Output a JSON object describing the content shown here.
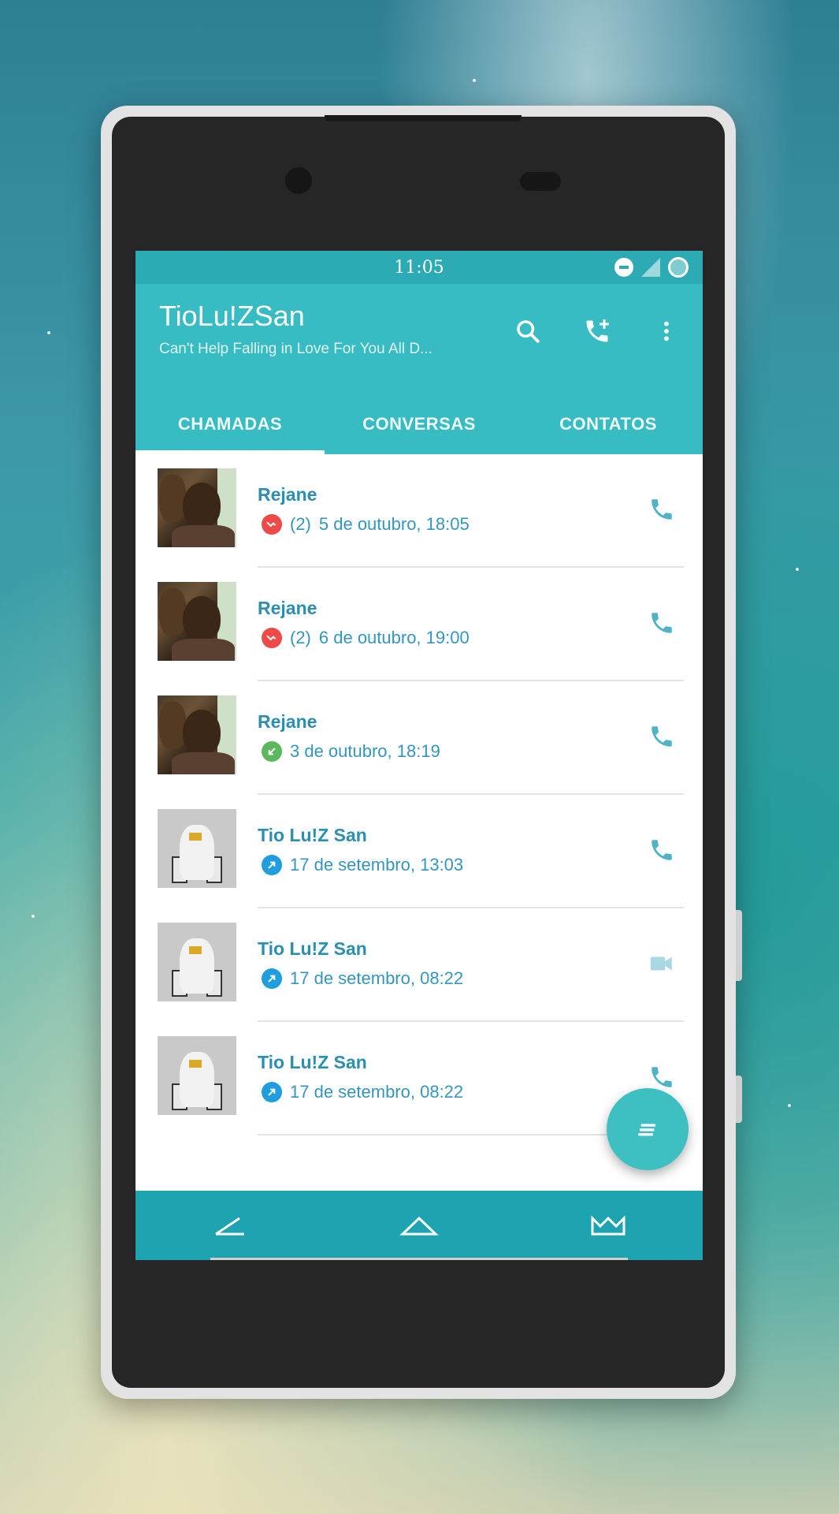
{
  "status_bar": {
    "time": "11:05"
  },
  "app_bar": {
    "title": "TioLu!ZSan",
    "subtitle": "Can't Help Falling in Love For You All D..."
  },
  "tabs": [
    {
      "label": "CHAMADAS",
      "selected": true
    },
    {
      "label": "CONVERSAS",
      "selected": false
    },
    {
      "label": "CONTATOS",
      "selected": false
    }
  ],
  "calls": [
    {
      "name": "Rejane",
      "count": "(2)",
      "date": "5 de outubro, 18:05",
      "status": "missed",
      "action_icon": "phone-icon"
    },
    {
      "name": "Rejane",
      "count": "(2)",
      "date": "6 de outubro, 19:00",
      "status": "missed",
      "action_icon": "phone-icon"
    },
    {
      "name": "Rejane",
      "count": "",
      "date": "3 de outubro, 18:19",
      "status": "received",
      "action_icon": "phone-icon"
    },
    {
      "name": "Tio Lu!Z San",
      "count": "",
      "date": "17 de setembro, 13:03",
      "status": "outgoing",
      "action_icon": "phone-icon"
    },
    {
      "name": "Tio Lu!Z San",
      "count": "",
      "date": "17 de setembro, 08:22",
      "status": "outgoing",
      "action_icon": "video-camera-icon"
    },
    {
      "name": "Tio Lu!Z San",
      "count": "",
      "date": "17 de setembro, 08:22",
      "status": "outgoing",
      "action_icon": "phone-icon"
    }
  ],
  "colors": {
    "primary": "#36bcc2",
    "status_bar": "#2cabb4",
    "name_text": "#2a8fb0",
    "missed": "#ef4a4a",
    "received": "#5cb85c",
    "outgoing": "#1e9ee0"
  }
}
